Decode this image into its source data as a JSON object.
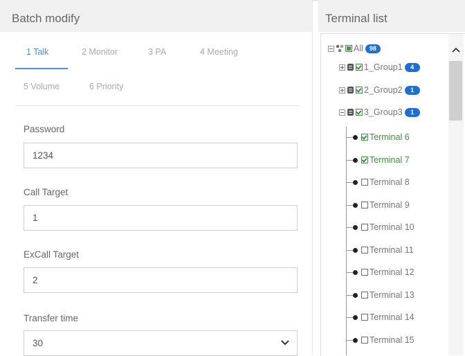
{
  "batch_modify": {
    "title": "Batch modify",
    "tabs": [
      {
        "label": "1 Talk",
        "active": true
      },
      {
        "label": "2 Monitor",
        "active": false
      },
      {
        "label": "3 PA",
        "active": false
      },
      {
        "label": "4 Meeting",
        "active": false
      },
      {
        "label": "5 Volume",
        "active": false
      },
      {
        "label": "6 Priority",
        "active": false
      }
    ],
    "fields": {
      "password": {
        "label": "Password",
        "value": "1234"
      },
      "call_target": {
        "label": "Call Target",
        "value": "1"
      },
      "excall_target": {
        "label": "ExCall Target",
        "value": "2"
      },
      "transfer_time": {
        "label": "Transfer time",
        "value": "30"
      }
    }
  },
  "terminal_list": {
    "title": "Terminal list",
    "root": {
      "label": "All",
      "badge": "98"
    },
    "groups": [
      {
        "label": "1_Group1",
        "badge": "4"
      },
      {
        "label": "2_Group2",
        "badge": "1"
      },
      {
        "label": "3_Group3",
        "badge": "1"
      }
    ],
    "terminals": [
      {
        "label": "Terminal 6",
        "checked": true
      },
      {
        "label": "Terminal 7",
        "checked": true
      },
      {
        "label": "Terminal 8",
        "checked": false
      },
      {
        "label": "Terminal 9",
        "checked": false
      },
      {
        "label": "Terminal 10",
        "checked": false
      },
      {
        "label": "Terminal 11",
        "checked": false
      },
      {
        "label": "Terminal 12",
        "checked": false
      },
      {
        "label": "Terminal 13",
        "checked": false
      },
      {
        "label": "Terminal 14",
        "checked": false
      },
      {
        "label": "Terminal 15",
        "checked": false
      }
    ]
  },
  "colors": {
    "accent": "#4a90d9",
    "badge": "#1f6fd1",
    "check": "#3f8f3f"
  }
}
